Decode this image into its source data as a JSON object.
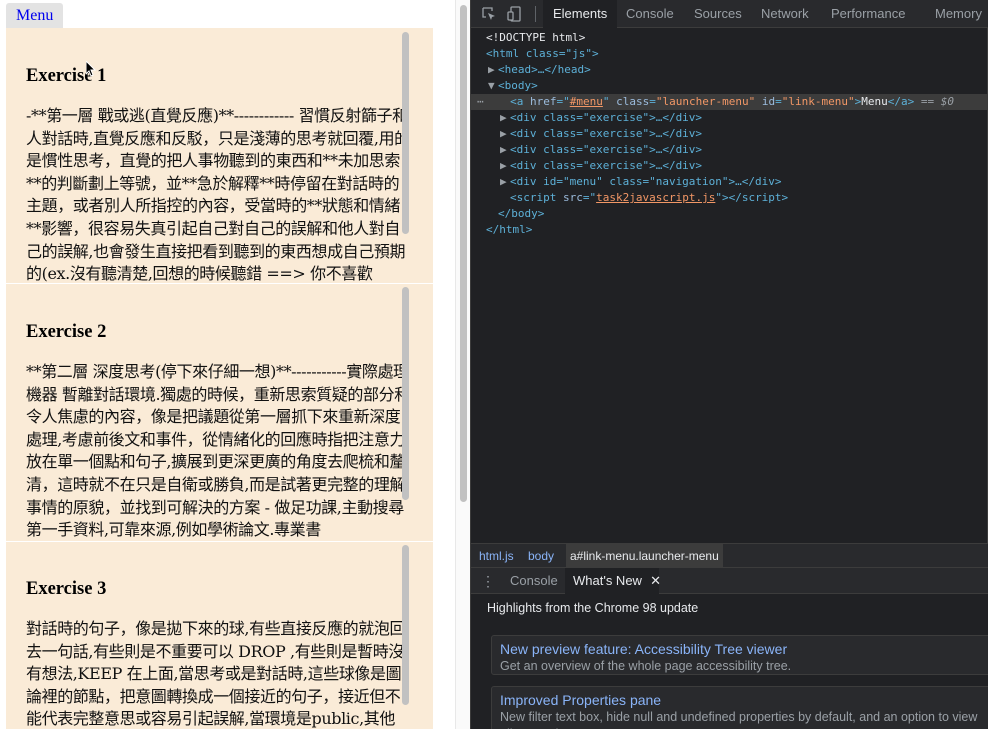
{
  "page": {
    "menu_link": "Menu",
    "exercises": [
      {
        "title": "Exercise 1",
        "text": "-**第一層 戰或逃(直覺反應)**------------ 習慣反射篩子和人對話時,直覺反應和反駁，只是淺薄的思考就回覆,用的是慣性思考，直覺的把人事物聽到的東西和**未加思索**的判斷劃上等號，並**急於解釋**時停留在對話時的主題，或者別人所指控的內容，受當時的**狀態和情緒**影響，很容易失真引起自己對自己的誤解和他人對自己的誤解,也會發生直接把看到聽到的東西想成自己預期的(ex.沒有聽清楚,回想的時候聽錯 ==> 你不喜歡"
      },
      {
        "title": "Exercise 2",
        "text": "**第二層 深度思考(停下來仔細一想)**-----------實際處理機器 暫離對話環境.獨處的時候，重新思索質疑的部分和令人焦慮的內容，像是把議題從第一層抓下來重新深度處理,考慮前後文和事件，從情緒化的回應時指把注意力放在單一個點和句子,擴展到更深更廣的角度去爬梳和釐清，這時就不在只是自衛或勝負,而是試著更完整的理解事情的原貌，並找到可解決的方案 - 做足功課,主動搜尋第一手資料,可靠來源,例如學術論文.專業書"
      },
      {
        "title": "Exercise 3",
        "text": "對話時的句子，像是拋下來的球,有些直接反應的就泡回去一句話,有些則是不重要可以 DROP ,有些則是暫時沒有想法,KEEP 在上面,當思考或是對話時,這些球像是圖論裡的節點，把意圖轉換成一個接近的句子，接近但不能代表完整意思或容易引起誤解,當環境是public,其他"
      }
    ]
  },
  "devtools": {
    "tabs": [
      "Elements",
      "Console",
      "Sources",
      "Network",
      "Performance",
      "Memory"
    ],
    "active_tab": "Elements",
    "dom": {
      "doctype": "<!DOCTYPE html>",
      "html_open": "<html class=\"js\">",
      "head": "<head>…</head>",
      "body_open": "<body>",
      "selected_line": {
        "tag_open": "<a",
        "attr_href": "href",
        "val_href": "#menu",
        "attr_class": "class",
        "val_class": "\"launcher-menu\"",
        "attr_id": "id",
        "val_id": "\"link-menu\"",
        "text": "Menu",
        "tag_close": "</a>",
        "suffix": "== $0"
      },
      "exercise_divs": [
        "<div class=\"exercise\">…</div>",
        "<div class=\"exercise\">…</div>",
        "<div class=\"exercise\">…</div>",
        "<div class=\"exercise\">…</div>"
      ],
      "nav_div": "<div id=\"menu\" class=\"navigation\">…</div>",
      "script_src": "task2javascript.js",
      "body_close": "</body>",
      "html_close": "</html>"
    },
    "breadcrumbs": [
      "html.js",
      "body",
      "a#link-menu.launcher-menu"
    ],
    "drawer_tabs": [
      "Console",
      "What's New"
    ],
    "drawer_active": "What's New",
    "highlights": "Highlights from the Chrome 98 update",
    "cards": [
      {
        "title": "New preview feature: Accessibility Tree viewer",
        "desc": "Get an overview of the whole page accessibility tree."
      },
      {
        "title": "Improved Properties pane",
        "desc": "New filter text box, hide null and undefined properties by default, and an option to view all properties."
      }
    ]
  }
}
